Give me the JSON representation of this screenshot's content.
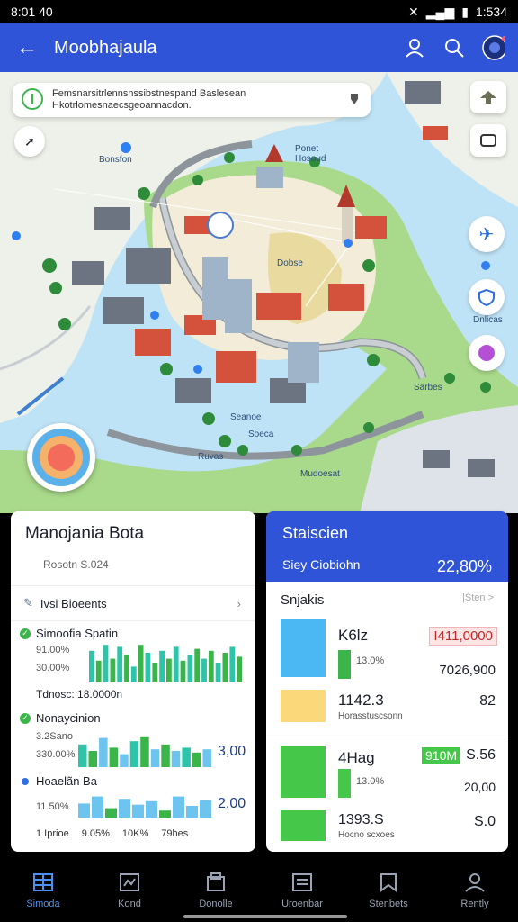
{
  "status": {
    "time": "8:01 40",
    "right_time": "1:534"
  },
  "appbar": {
    "title": "Moobhajaula"
  },
  "map": {
    "search_text_1": "Femsnarsitrlennsnssibstnespand Baslesean",
    "search_text_2": "Hkotrlomesnaecsgeoannacdon.",
    "labels": [
      "Ponet Hosoud",
      "Dobse",
      "Dnlicas",
      "Seanoe",
      "Soeca",
      "Ruvas",
      "Mudoesat",
      "Sarbes",
      "Bonsfon"
    ]
  },
  "left_card": {
    "title": "Manojania Bota",
    "subtitle": "Rosotn S.024",
    "row_label": "Ivsi Bioeents",
    "section1": {
      "title": "Simoofia Spatin",
      "ylabels": [
        "91.00%",
        "30.00%"
      ],
      "footer": "Tdnosc: 18.0000n",
      "bars": [
        0.8,
        0.55,
        0.95,
        0.6,
        0.9,
        0.7,
        0.4,
        0.95,
        0.75,
        0.5,
        0.8,
        0.6,
        0.9,
        0.55,
        0.7,
        0.85,
        0.6,
        0.8,
        0.5,
        0.75,
        0.9,
        0.65
      ]
    },
    "section2": {
      "title": "Nonaycinion",
      "ylabels": [
        "3.2Sano",
        "330.00%"
      ],
      "value": "3,00",
      "bars": [
        0.7,
        0.5,
        0.9,
        0.6,
        0.4,
        0.8,
        0.95,
        0.55,
        0.7,
        0.5,
        0.6,
        0.45,
        0.55
      ]
    },
    "section3": {
      "title": "Hoaelãn Ba",
      "ylabel": "11.50%",
      "value": "2,00",
      "footer": [
        "1 Iprioe",
        "9.05%",
        "10K%",
        "79hes"
      ],
      "bars": [
        0.6,
        0.9,
        0.4,
        0.8,
        0.55,
        0.7,
        0.3,
        0.9,
        0.5,
        0.75
      ]
    }
  },
  "right_card": {
    "header_title": "Staiscien",
    "header_sub": "Siey Ciobiohn",
    "header_value": "22,80%",
    "section_title": "Snjakis",
    "section_link": "|Sten >",
    "items": [
      {
        "label": "K6lz",
        "sub": "13.0%",
        "value_red": "I411,0000",
        "value2": "7026,900",
        "swatch": "#4cb8f3",
        "bar": "#3bb54a"
      },
      {
        "label": "1142.3",
        "sub": "Horasstuscsonn",
        "value": "82",
        "swatch": "#fbd97a"
      },
      {
        "label": "4Hag",
        "sub": "13.0%",
        "value_badge": "910M",
        "value": "S.56",
        "value2": "20,00",
        "swatch": "#45c84a",
        "bar": "#45c84a"
      },
      {
        "label": "1393.S",
        "sub": "Hocno scxoes",
        "value": "S.0",
        "swatch": "#45c84a"
      }
    ]
  },
  "bottom_nav": [
    {
      "label": "Simoda",
      "icon": "grid-icon"
    },
    {
      "label": "Kond",
      "icon": "map-icon"
    },
    {
      "label": "Donolle",
      "icon": "box-icon"
    },
    {
      "label": "Uroenbar",
      "icon": "list-icon"
    },
    {
      "label": "Stenbets",
      "icon": "bookmark-icon"
    },
    {
      "label": "Rently",
      "icon": "person-icon"
    }
  ],
  "colors": {
    "primary": "#2f54d8",
    "green": "#3bb54a",
    "teal": "#2ec4a9",
    "lightblue": "#6cc4ef",
    "red": "#e74b3c"
  }
}
